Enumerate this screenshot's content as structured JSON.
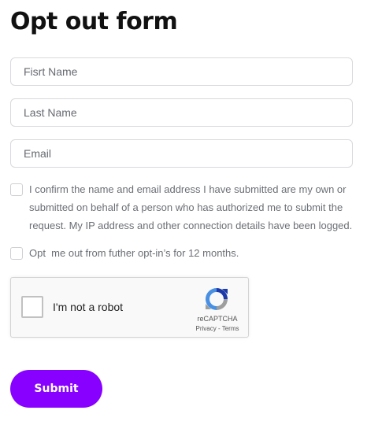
{
  "form": {
    "title": "Opt out form",
    "first_name_placeholder": "Fisrt Name",
    "last_name_placeholder": "Last Name",
    "email_placeholder": "Email",
    "consent_text": "I confirm the name and email address I have submitted are my own or submitted on behalf of a person who has authorized me to submit the request. My IP address and other connection details have been logged.",
    "optout_text": "Opt  me out from futher opt-in’s for 12 months.",
    "submit_label": "Submit",
    "accent_color": "#8800ff"
  },
  "recaptcha": {
    "label": "I'm not a robot",
    "brand": "reCAPTCHA",
    "privacy": "Privacy",
    "separator": " - ",
    "terms": "Terms",
    "icon": "recaptcha-logo-icon"
  }
}
